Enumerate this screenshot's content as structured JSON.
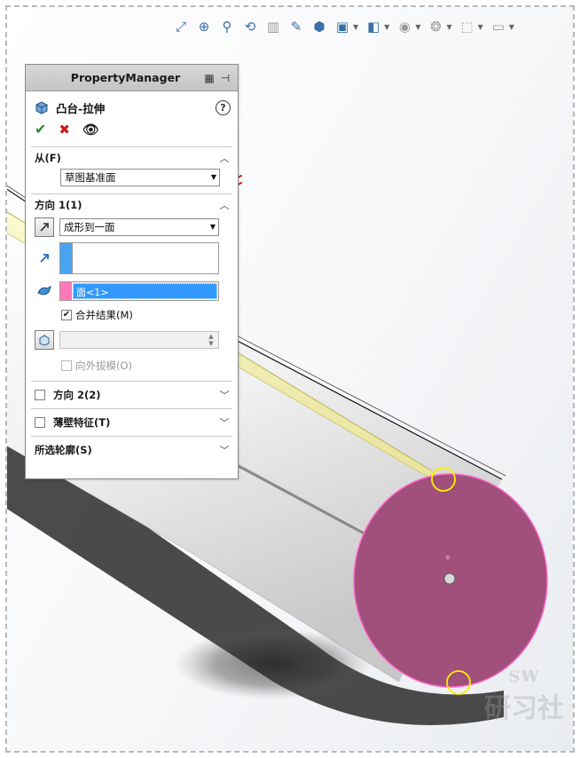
{
  "property_manager": {
    "title": "PropertyManager",
    "feature_name": "凸台-拉伸",
    "help_label": "?",
    "from": {
      "title": "从(F)",
      "start_condition": "草图基准面"
    },
    "direction1": {
      "title": "方向 1(1)",
      "end_condition": "成形到一面",
      "selected_face": "面<1>",
      "merge_result_label": "合并结果(M)",
      "merge_result_checked": true,
      "draft_outward_label": "向外拔模(O)",
      "draft_outward_checked": false
    },
    "direction2": {
      "title": "方向 2(2)",
      "checked": false
    },
    "thin_feature": {
      "title": "薄壁特征(T)",
      "checked": false
    },
    "selected_contours": {
      "title": "所选轮廓(S)"
    }
  },
  "watermark": {
    "top": "SW",
    "text": "研习社"
  },
  "icons": {
    "ok": "checkmark-icon",
    "cancel": "cross-icon",
    "preview": "eye-icon",
    "collapse": "chevron-up-icon",
    "expand": "chevron-down-icon"
  },
  "colors": {
    "end_face": "#a0507a",
    "face_outline": "#ff66cc",
    "selection_blue": "#3399ff",
    "face_tag_pink": "#ff77bb",
    "rod_yellow": "#f3f0a8",
    "arrow_red": "#e01e1e"
  }
}
